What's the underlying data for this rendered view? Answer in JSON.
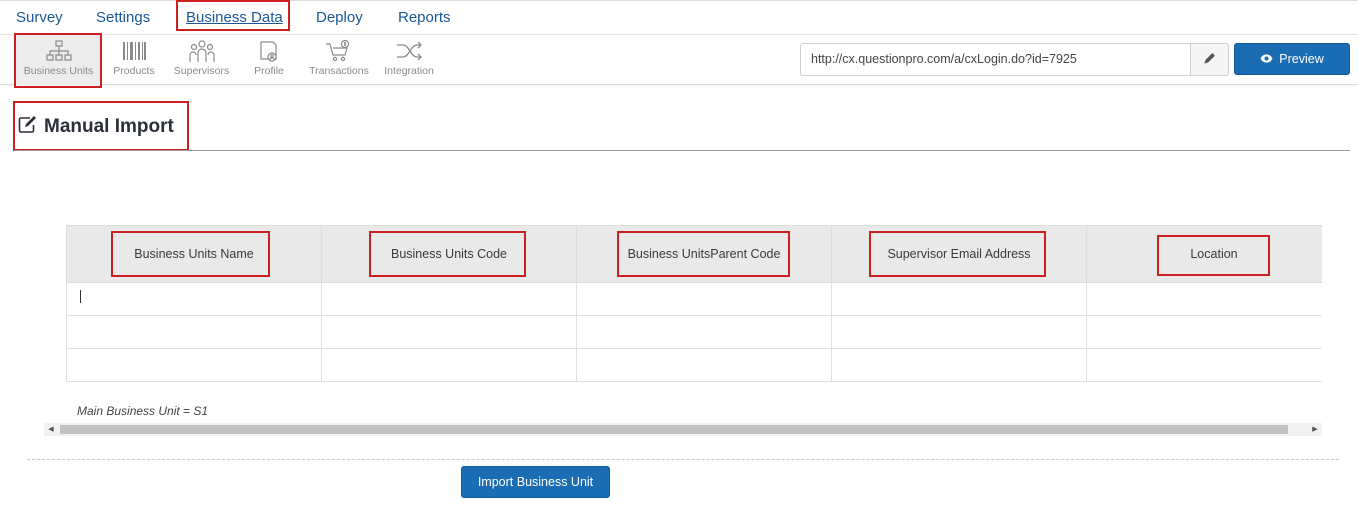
{
  "nav": {
    "items": [
      {
        "label": "Survey"
      },
      {
        "label": "Settings"
      },
      {
        "label": "Business Data"
      },
      {
        "label": "Deploy"
      },
      {
        "label": "Reports"
      }
    ],
    "active": "Business Data"
  },
  "subnav": {
    "items": [
      {
        "label": "Business Units",
        "icon": "org-chart-icon"
      },
      {
        "label": "Products",
        "icon": "barcode-icon"
      },
      {
        "label": "Supervisors",
        "icon": "people-group-icon"
      },
      {
        "label": "Profile",
        "icon": "profile-book-icon"
      },
      {
        "label": "Transactions",
        "icon": "cart-icon"
      },
      {
        "label": "Integration",
        "icon": "shuffle-icon"
      }
    ],
    "active": "Business Units"
  },
  "toolbar": {
    "url": "http://cx.questionpro.com/a/cxLogin.do?id=7925",
    "preview_label": "Preview"
  },
  "page": {
    "title": "Manual Import"
  },
  "table": {
    "headers": [
      "Business Units Name",
      "Business Units Code",
      "Business UnitsParent Code",
      "Supervisor Email Address",
      "Location"
    ],
    "rows": [
      [
        "",
        "",
        "",
        "",
        ""
      ],
      [
        "",
        "",
        "",
        "",
        ""
      ],
      [
        "",
        "",
        "",
        "",
        ""
      ]
    ]
  },
  "note": "Main Business Unit = S1",
  "actions": {
    "import_label": "Import Business Unit"
  },
  "colors": {
    "link": "#1a5799",
    "primary": "#1a6db3",
    "annotation": "#cc1f1f"
  }
}
